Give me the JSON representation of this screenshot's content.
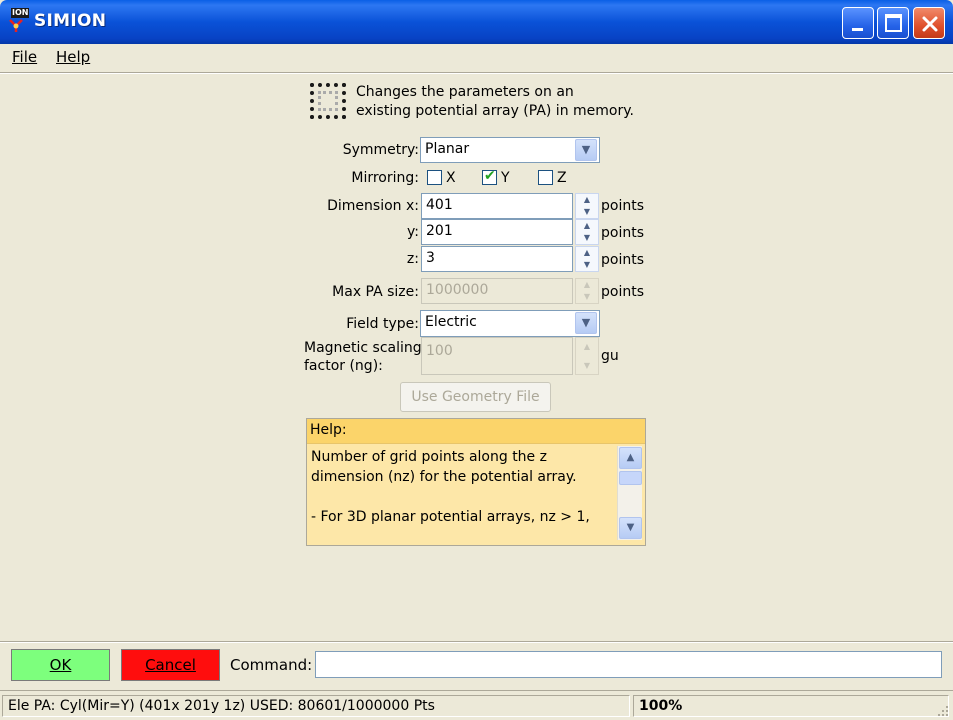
{
  "window": {
    "app_icon_text": "ION",
    "title": "SIMION"
  },
  "menu": {
    "file": "File",
    "help": "Help"
  },
  "header": {
    "line1": "Changes the parameters on an",
    "line2": "existing potential array (PA) in memory."
  },
  "form": {
    "symmetry_label": "Symmetry:",
    "symmetry_value": "Planar",
    "mirroring_label": "Mirroring:",
    "mirror_x": "X",
    "mirror_y": "Y",
    "mirror_z": "Z",
    "mirror_x_checked": false,
    "mirror_y_checked": true,
    "mirror_z_checked": false,
    "dim_x_label": "Dimension x:",
    "dim_x_value": "401",
    "dim_y_label": "y:",
    "dim_y_value": "201",
    "dim_z_label": "z:",
    "dim_z_value": "3",
    "points_unit": "points",
    "max_pa_label": "Max PA size:",
    "max_pa_value": "1000000",
    "field_type_label": "Field type:",
    "field_type_value": "Electric",
    "mag_label_line1": "Magnetic scaling",
    "mag_label_line2": "factor (ng):",
    "mag_value": "100",
    "mag_unit": "gu",
    "geometry_button": "Use Geometry File"
  },
  "help": {
    "header": "Help:",
    "line1": "Number of grid points along the z",
    "line2": "dimension (nz) for the potential array.",
    "line3": "",
    "line4": "- For 3D planar potential arrays, nz > 1,"
  },
  "bottom": {
    "ok": "OK",
    "cancel": "Cancel",
    "command_label": "Command:",
    "command_value": "",
    "ok_color": "#7dff7d",
    "cancel_color": "#ff0d0d"
  },
  "status": {
    "pa_info": "Ele PA: Cyl(Mir=Y) (401x 201y 1z)  USED: 80601/1000000 Pts",
    "zoom": "100%"
  }
}
